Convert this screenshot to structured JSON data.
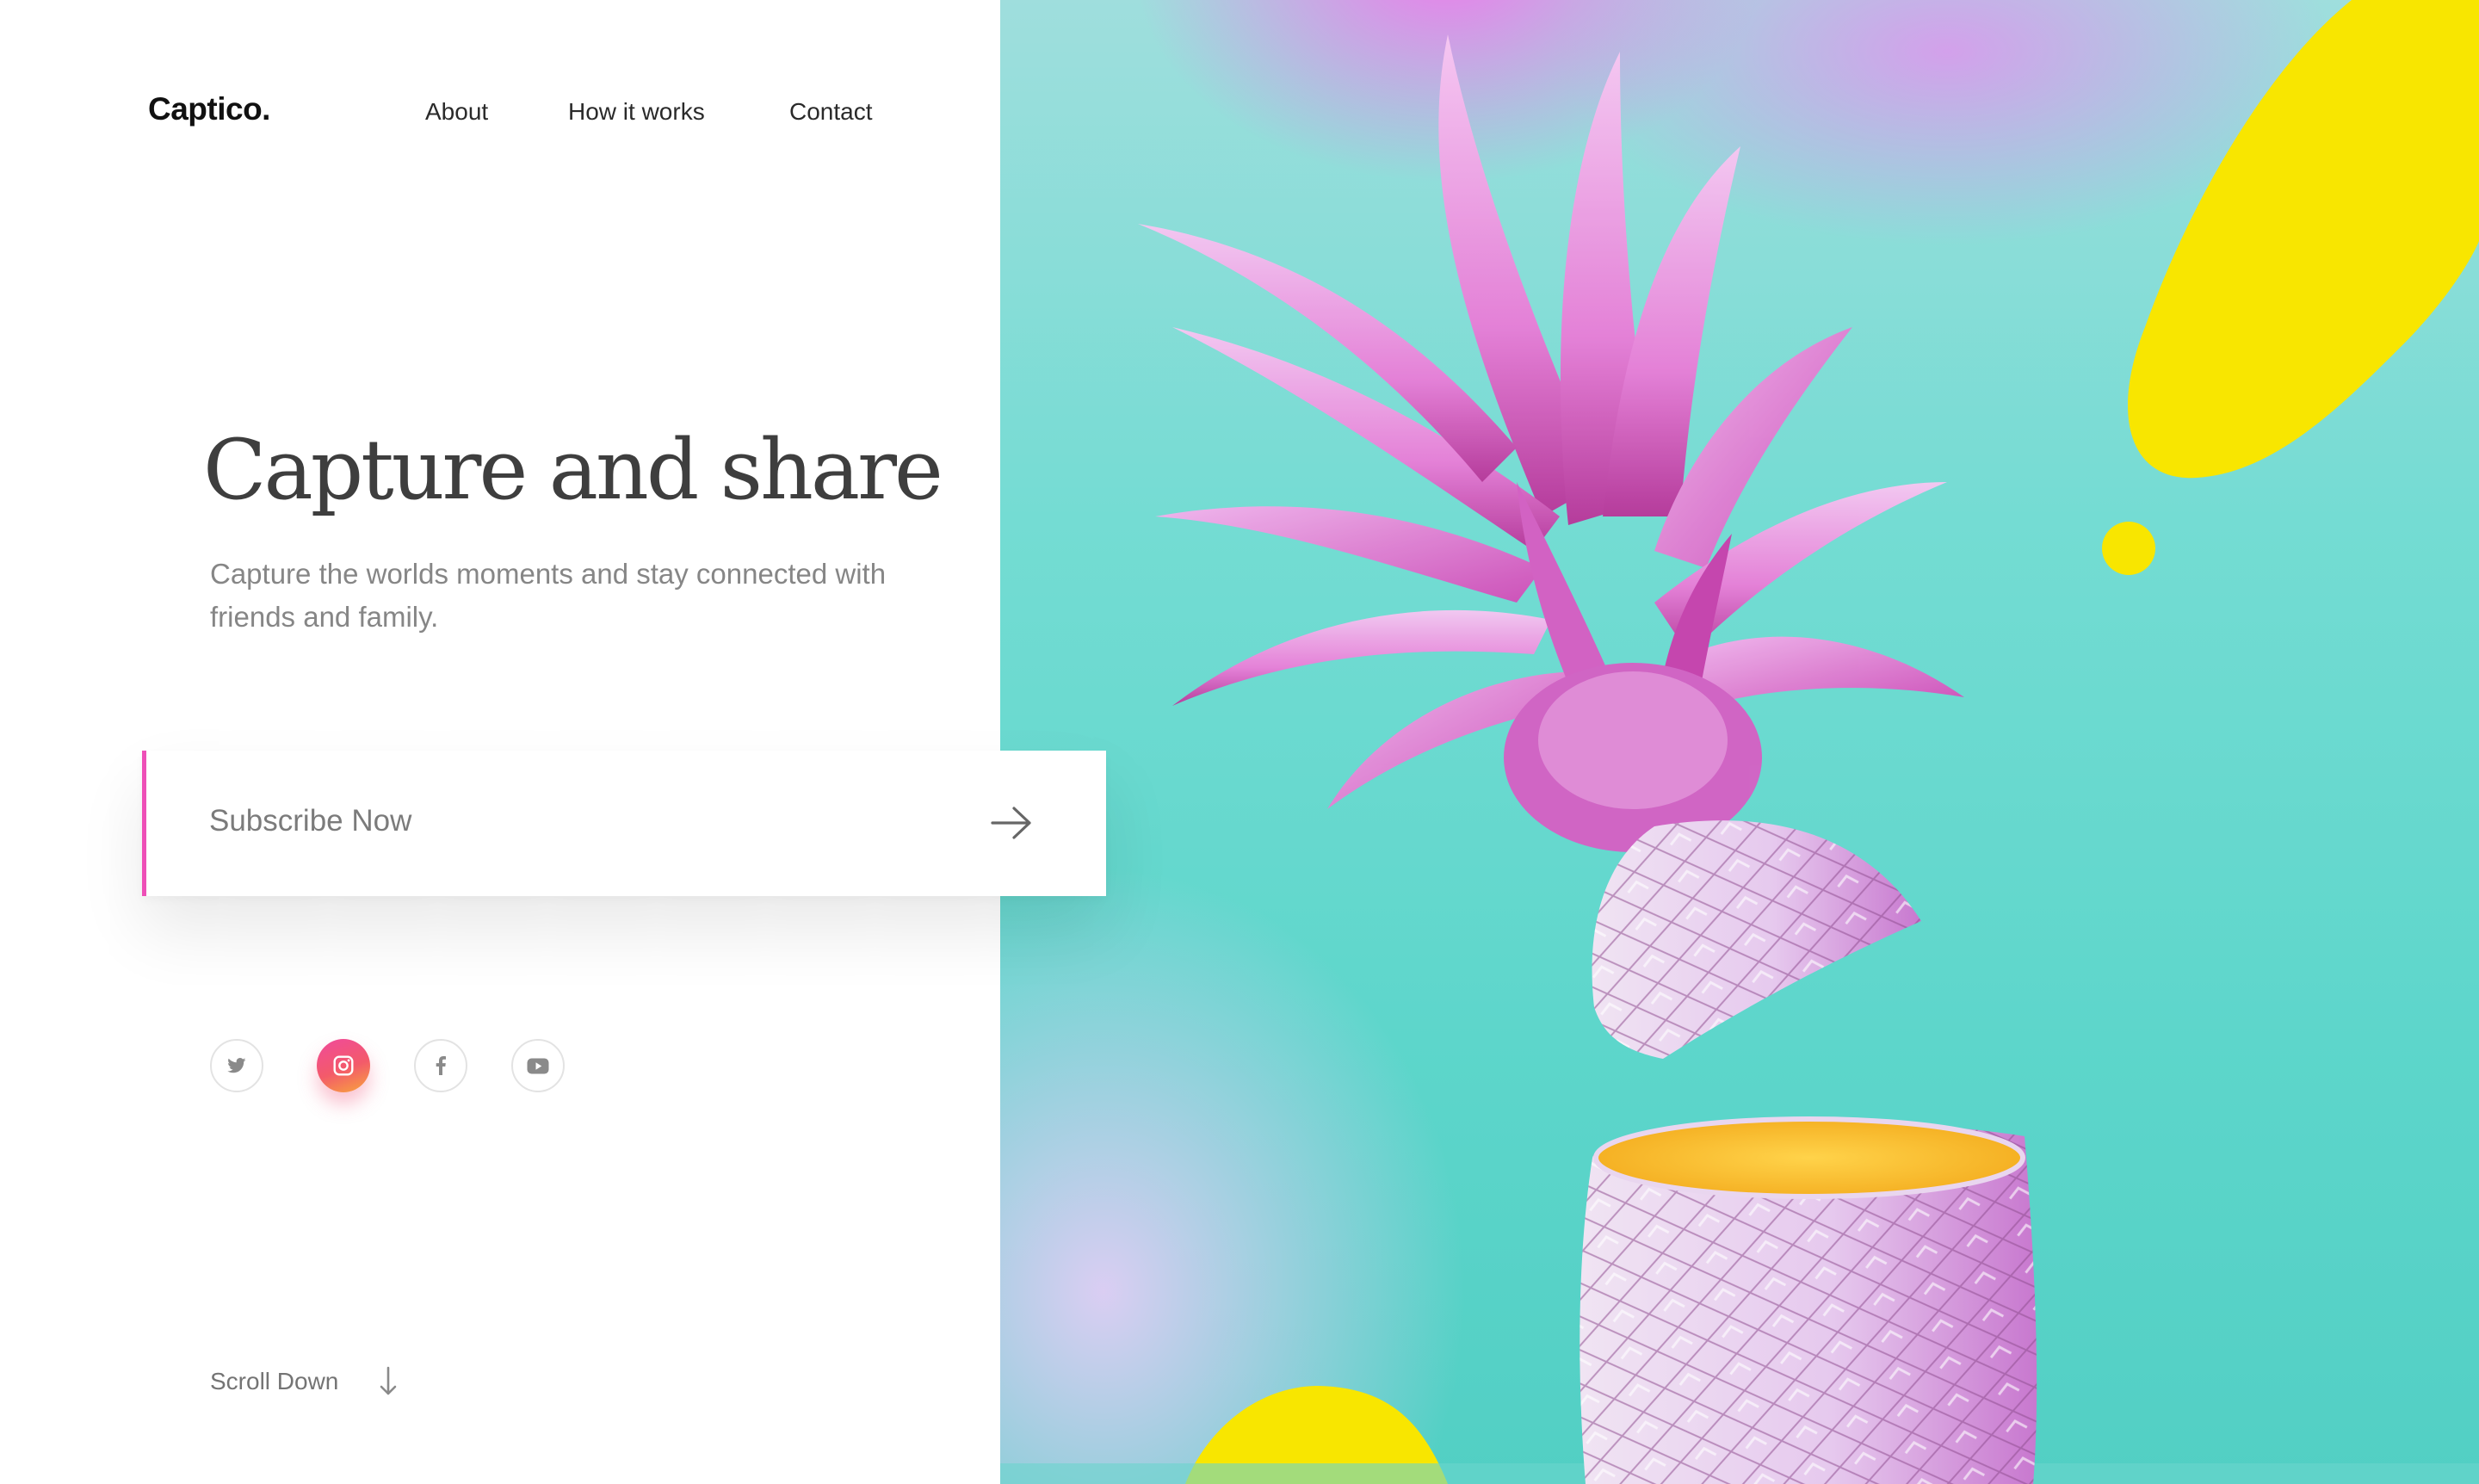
{
  "brand": {
    "logo": "Captico."
  },
  "nav": {
    "items": [
      {
        "label": "About"
      },
      {
        "label": "How it works"
      },
      {
        "label": "Contact"
      }
    ]
  },
  "hero": {
    "title": "Capture and share",
    "subtitle": "Capture the worlds moments and stay connected with friends and family."
  },
  "subscribe": {
    "label": "Subscribe Now",
    "button_icon": "arrow-right-icon",
    "accent_color": "#ee4fb7"
  },
  "social": [
    {
      "icon": "twitter-icon"
    },
    {
      "icon": "instagram-icon",
      "active": true
    },
    {
      "icon": "facebook-icon"
    },
    {
      "icon": "youtube-icon"
    }
  ],
  "scroll": {
    "label": "Scroll Down",
    "icon": "arrow-down-icon"
  },
  "image": {
    "subject": "pineapple-icon",
    "colors": {
      "background": "#5dd6cb",
      "pink": "#ee78eb",
      "yellow": "#f8e600"
    }
  }
}
